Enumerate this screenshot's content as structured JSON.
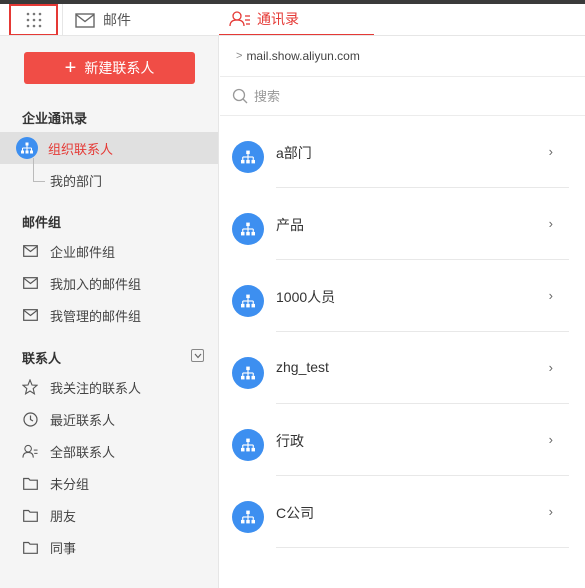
{
  "header": {
    "apps_icon": "grid-icon",
    "mail_tab": "邮件",
    "contacts_tab": "通讯录",
    "accent": "#e53935"
  },
  "sidebar": {
    "new_button": "新建联系人",
    "enterprise_section": "企业通讯录",
    "org_contacts": "组织联系人",
    "my_department": "我的部门",
    "mailgroup_section": "邮件组",
    "mailgroup_items": [
      "企业邮件组",
      "我加入的邮件组",
      "我管理的邮件组"
    ],
    "contacts_section": "联系人",
    "contact_items": [
      "我关注的联系人",
      "最近联系人",
      "全部联系人",
      "未分组",
      "朋友",
      "同事"
    ]
  },
  "main": {
    "domain": "mail.show.aliyun.com",
    "search_placeholder": "搜索",
    "departments": [
      "a部门",
      "产品",
      "1000人员",
      "zhg_test",
      "行政",
      "C公司"
    ]
  }
}
